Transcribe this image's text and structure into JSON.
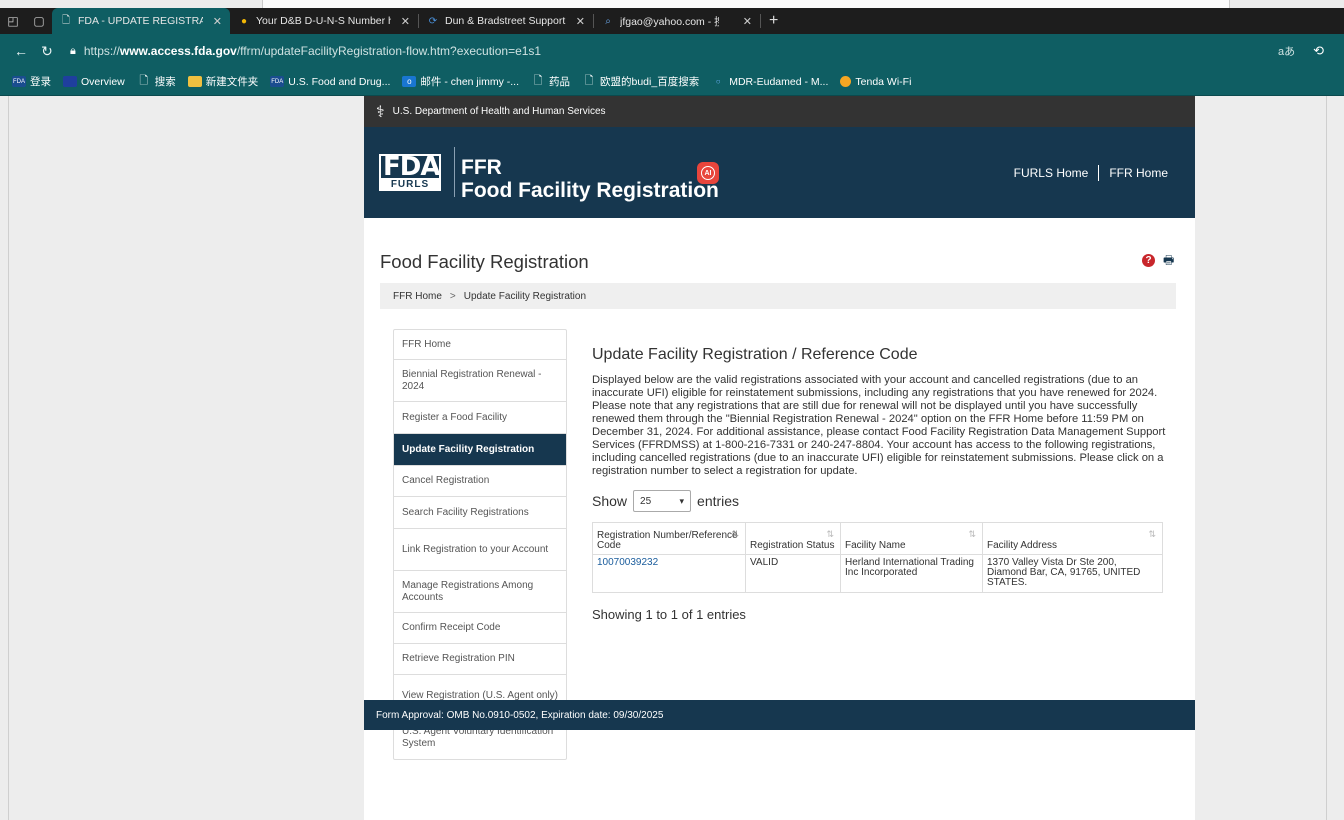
{
  "browser": {
    "tabs": [
      {
        "title": "FDA - UPDATE REGISTRATION (FA",
        "active": true
      },
      {
        "title": "Your D&B D-U-N-S Number has",
        "active": false
      },
      {
        "title": "Dun & Bradstreet Support Page -",
        "active": false
      },
      {
        "title": "jfgao@yahoo.com - 搜索",
        "active": false
      }
    ],
    "new_tab": "+",
    "url_prefix": "https://",
    "url_host": "www.access.fda.gov",
    "url_path": "/ffrm/updateFacilityRegistration-flow.htm?execution=e1s1",
    "read_aloud": "aあ",
    "bookmarks": [
      {
        "label": "登录",
        "icon": "FDA"
      },
      {
        "label": "Overview",
        "icon": "EU"
      },
      {
        "label": "搜索",
        "icon": "page"
      },
      {
        "label": "新建文件夹",
        "icon": "folder"
      },
      {
        "label": "U.S. Food and Drug...",
        "icon": "FDA"
      },
      {
        "label": "邮件 - chen jimmy -...",
        "icon": "mail"
      },
      {
        "label": "药品",
        "icon": "page"
      },
      {
        "label": "欧盟的budi_百度搜索",
        "icon": "page"
      },
      {
        "label": "MDR-Eudamed - M...",
        "icon": "circle"
      },
      {
        "label": "Tenda Wi-Fi",
        "icon": "wifi"
      }
    ]
  },
  "site": {
    "hhs_label": "U.S. Department of Health and Human Services",
    "logo_top": "FDA",
    "logo_bottom": "FURLS",
    "title_line1": "FFR",
    "title_line2": "Food Facility Registration",
    "ai_badge": "AI",
    "links": [
      "FURLS Home",
      "FFR Home"
    ]
  },
  "page": {
    "title": "Food Facility Registration",
    "breadcrumb": [
      "FFR Home",
      "Update Facility Registration"
    ],
    "sidenav": [
      {
        "label": "FFR Home",
        "active": false
      },
      {
        "label": "Biennial Registration Renewal - 2024",
        "active": false
      },
      {
        "label": "Register a Food Facility",
        "active": false
      },
      {
        "label": "Update Facility Registration",
        "active": true
      },
      {
        "label": "Cancel Registration",
        "active": false
      },
      {
        "label": "Search Facility Registrations",
        "active": false
      },
      {
        "label": "Link Registration to your Account",
        "active": false
      },
      {
        "label": "Manage Registrations Among Accounts",
        "active": false
      },
      {
        "label": "Confirm Receipt Code",
        "active": false
      },
      {
        "label": "Retrieve Registration PIN",
        "active": false
      },
      {
        "label": "View Registration (U.S. Agent only)",
        "active": false
      },
      {
        "label": "U.S. Agent Voluntary Identification System",
        "active": false
      }
    ],
    "heading": "Update Facility Registration / Reference Code",
    "description": "Displayed below are the valid registrations associated with your account and cancelled registrations (due to an inaccurate UFI) eligible for reinstatement submissions, including any registrations that you have renewed for 2024. Please note that any registrations that are still due for renewal will not be displayed until you have successfully renewed them through the \"Biennial Registration Renewal - 2024\" option on the FFR Home before 11:59 PM on December 31, 2024. For additional assistance, please contact Food Facility Registration Data Management Support Services (FFRDMSS) at 1-800-216-7331 or 240-247-8804. Your account has access to the following registrations, including cancelled registrations (due to an inaccurate UFI) eligible for reinstatement submissions. Please click on a registration number to select a registration for update.",
    "show_label": "Show",
    "entries_value": "25",
    "entries_label": "entries",
    "table": {
      "headers": [
        "Registration Number/Reference Code",
        "Registration Status",
        "Facility Name",
        "Facility Address"
      ],
      "rows": [
        [
          "10070039232",
          "VALID",
          "Herland International Trading Inc Incorporated",
          "1370 Valley Vista Dr Ste 200, Diamond Bar, CA, 91765, UNITED STATES."
        ]
      ]
    },
    "showing": "Showing 1 to 1 of 1 entries",
    "footer": "Form Approval: OMB No.0910-0502, Expiration date: 09/30/2025"
  }
}
